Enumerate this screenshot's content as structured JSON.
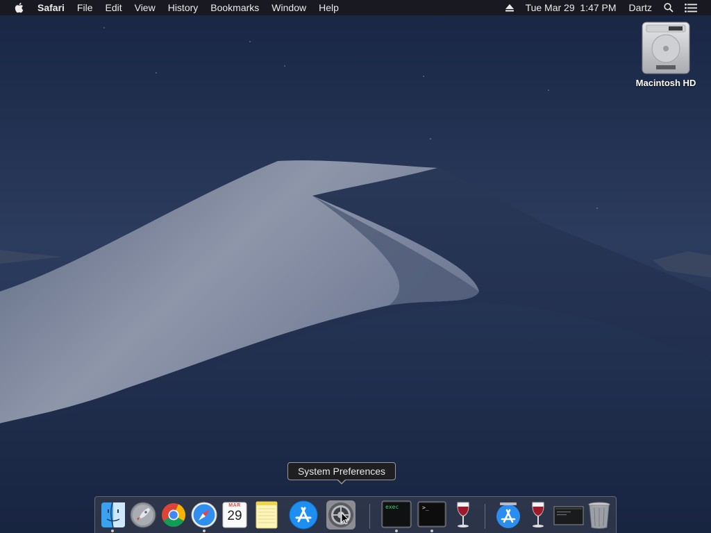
{
  "menubar": {
    "app_name": "Safari",
    "menus": [
      "File",
      "Edit",
      "View",
      "History",
      "Bookmarks",
      "Window",
      "Help"
    ],
    "clock": "Tue Mar 29  1:47 PM",
    "user": "Dartz"
  },
  "desktop": {
    "hd_label": "Macintosh HD"
  },
  "tooltip": {
    "text": "System Preferences"
  },
  "dock": {
    "items": [
      {
        "name": "Finder",
        "icon": "finder-icon",
        "running": true
      },
      {
        "name": "Launchpad",
        "icon": "launchpad-icon",
        "running": false
      },
      {
        "name": "Google Chrome",
        "icon": "chrome-icon",
        "running": false
      },
      {
        "name": "Safari",
        "icon": "safari-icon",
        "running": true
      },
      {
        "name": "Calendar",
        "icon": "calendar-icon",
        "running": false,
        "month": "MAR",
        "day": "29"
      },
      {
        "name": "Notes",
        "icon": "notes-icon",
        "running": false
      },
      {
        "name": "App Store",
        "icon": "app-store-icon",
        "running": false
      },
      {
        "name": "System Preferences",
        "icon": "system-preferences-icon",
        "running": false
      },
      {
        "name": "exec",
        "icon": "terminal-exec-icon",
        "running": true,
        "label": "exec"
      },
      {
        "name": "Terminal",
        "icon": "terminal-icon",
        "running": true,
        "label": ">_"
      },
      {
        "name": "Wine",
        "icon": "wine-icon",
        "running": false
      },
      {
        "name": "App Store Downloads",
        "icon": "app-store-folder-icon",
        "running": false
      },
      {
        "name": "Wine",
        "icon": "wine-icon",
        "running": false
      },
      {
        "name": "Window",
        "icon": "window-thumbnail-icon",
        "running": false
      },
      {
        "name": "Trash",
        "icon": "trash-icon",
        "running": false
      }
    ]
  },
  "colors": {
    "menubar_bg": "#18181c",
    "sky_top": "#1a2848",
    "sky_bottom": "#2c3c5c",
    "dune_light": "#8a92a6",
    "dune_dark": "#1c2a48"
  }
}
